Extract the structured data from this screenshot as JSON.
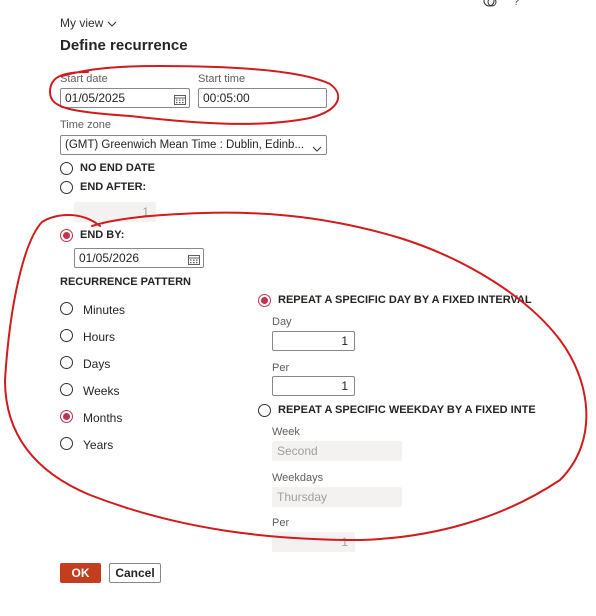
{
  "header": {
    "view_label": "My view",
    "title": "Define recurrence"
  },
  "start": {
    "date_label": "Start date",
    "date_value": "01/05/2025",
    "time_label": "Start time",
    "time_value": "00:05:00"
  },
  "timezone": {
    "label": "Time zone",
    "value": "(GMT) Greenwich Mean Time : Dublin, Edinb..."
  },
  "end": {
    "no_end_label": "NO END DATE",
    "after_label": "END AFTER:",
    "after_value": "1",
    "by_label": "END BY:",
    "by_value": "01/05/2026",
    "selected": "END BY:"
  },
  "pattern": {
    "label": "RECURRENCE PATTERN",
    "options": [
      "Minutes",
      "Hours",
      "Days",
      "Weeks",
      "Months",
      "Years"
    ],
    "selected": "Months"
  },
  "monthly": {
    "specific_day_label": "REPEAT A SPECIFIC DAY BY A FIXED INTERVAL",
    "day_label": "Day",
    "day_value": "1",
    "per_label": "Per",
    "per_value": "1",
    "specific_weekday_label": "REPEAT A SPECIFIC WEEKDAY BY A FIXED INTERVA",
    "week_label": "Week",
    "week_value": "Second",
    "weekdays_label": "Weekdays",
    "weekdays_value": "Thursday",
    "per2_label": "Per",
    "per2_value": "1",
    "selected": "REPEAT A SPECIFIC DAY BY A FIXED INTERVAL"
  },
  "footer": {
    "ok_label": "OK",
    "cancel_label": "Cancel"
  },
  "colors": {
    "accent": "#c43d1e",
    "annotation": "#d01c1c"
  }
}
